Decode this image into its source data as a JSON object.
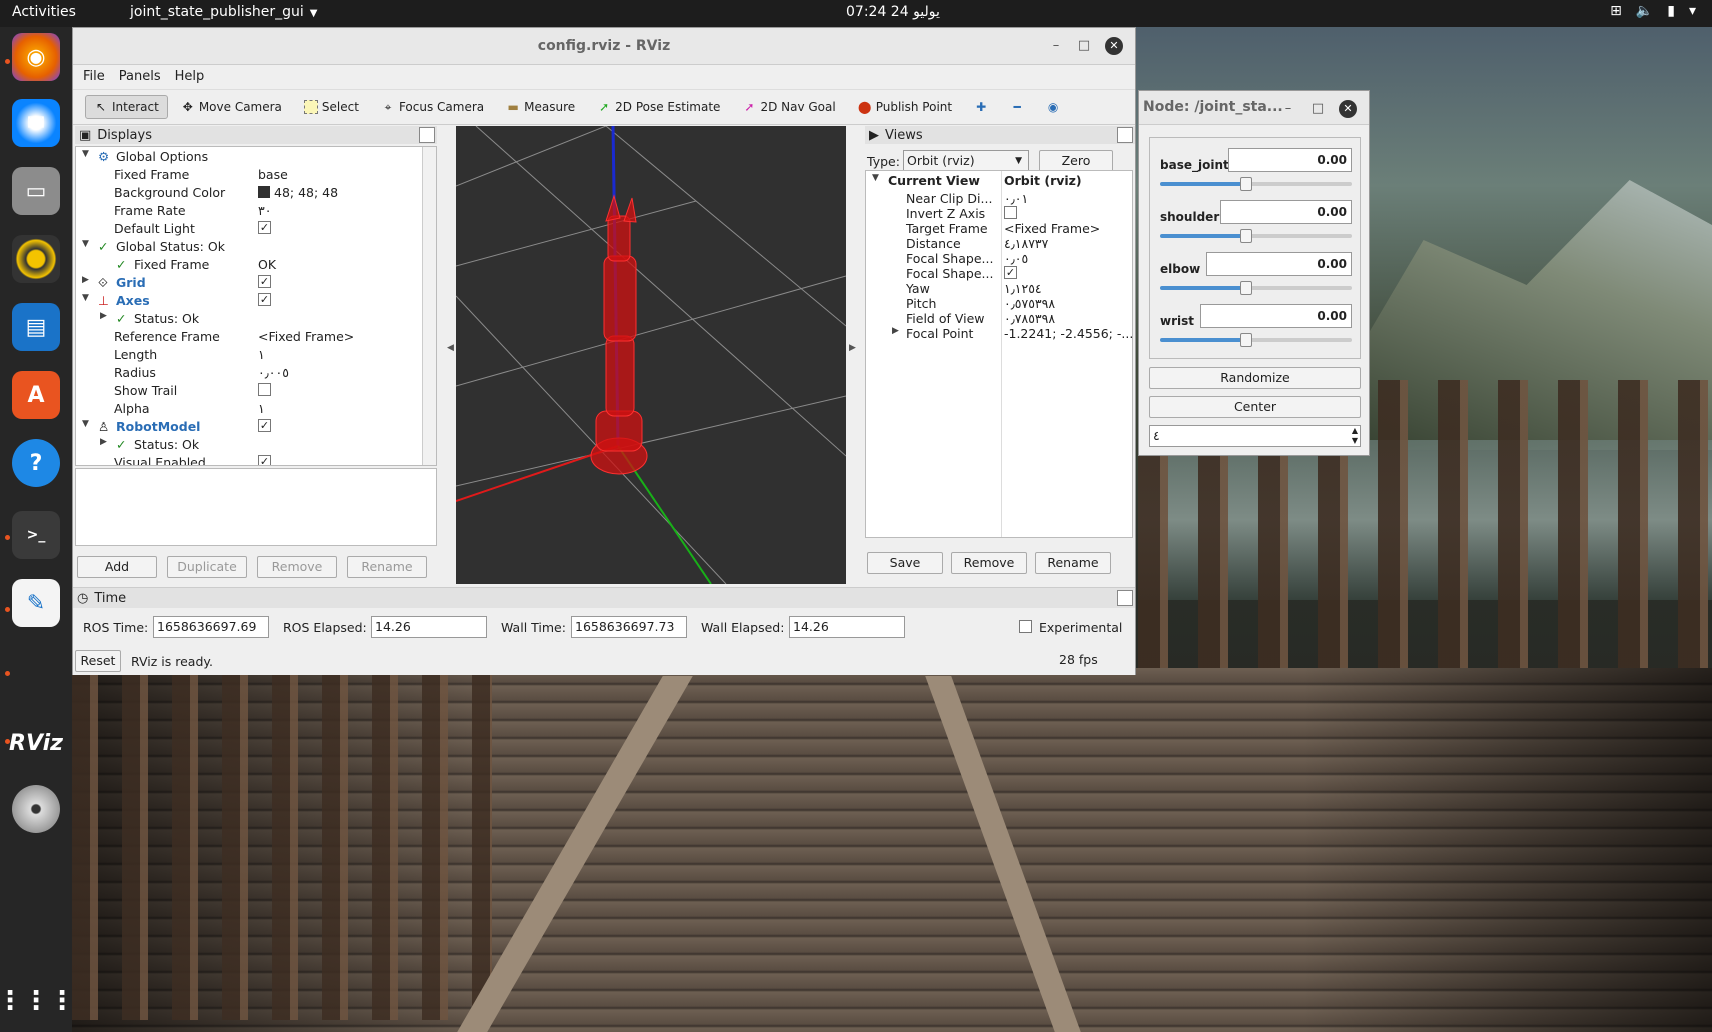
{
  "topbar": {
    "activities": "Activities",
    "app_menu": "joint_state_publisher_gui",
    "clock": "07:24  24 يوليو"
  },
  "dock": {
    "icons": [
      "firefox-icon",
      "thunderbird-icon",
      "files-icon",
      "rhythmbox-icon",
      "writer-icon",
      "software-icon",
      "help-icon",
      "terminal-icon",
      "text-editor-icon",
      "rviz-icon",
      "disc-icon",
      "apps-grid-icon"
    ],
    "rviz_label": "RViz"
  },
  "rviz": {
    "title": "config.rviz - RViz",
    "menu": [
      "File",
      "Panels",
      "Help"
    ],
    "toolbar": [
      "Interact",
      "Move Camera",
      "Select",
      "Focus Camera",
      "Measure",
      "2D Pose Estimate",
      "2D Nav Goal",
      "Publish Point"
    ],
    "displays": {
      "title": "Displays",
      "rows": [
        {
          "k": "Global Options",
          "v": ""
        },
        {
          "k": "Fixed Frame",
          "v": "base"
        },
        {
          "k": "Background Color",
          "v": "48; 48; 48"
        },
        {
          "k": "Frame Rate",
          "v": "٣٠"
        },
        {
          "k": "Default Light",
          "v": ""
        },
        {
          "k": "Global Status: Ok",
          "v": ""
        },
        {
          "k": "Fixed Frame",
          "v": "OK"
        },
        {
          "k": "Grid",
          "v": ""
        },
        {
          "k": "Axes",
          "v": ""
        },
        {
          "k": "Status: Ok",
          "v": ""
        },
        {
          "k": "Reference Frame",
          "v": "<Fixed Frame>"
        },
        {
          "k": "Length",
          "v": "١"
        },
        {
          "k": "Radius",
          "v": "٠٫٠٠٥"
        },
        {
          "k": "Show Trail",
          "v": ""
        },
        {
          "k": "Alpha",
          "v": "١"
        },
        {
          "k": "RobotModel",
          "v": ""
        },
        {
          "k": "Status: Ok",
          "v": ""
        },
        {
          "k": "Visual Enabled",
          "v": ""
        }
      ],
      "buttons": [
        "Add",
        "Duplicate",
        "Remove",
        "Rename"
      ]
    },
    "views": {
      "title": "Views",
      "type_label": "Type:",
      "type_value": "Orbit (rviz)",
      "zero": "Zero",
      "current_view": "Current View",
      "current_view_value": "Orbit (rviz)",
      "rows": [
        {
          "k": "Near Clip Di...",
          "v": "٠٫٠١"
        },
        {
          "k": "Invert Z Axis",
          "v": ""
        },
        {
          "k": "Target Frame",
          "v": "<Fixed Frame>"
        },
        {
          "k": "Distance",
          "v": "٤٫١٨٧٣٧"
        },
        {
          "k": "Focal Shape...",
          "v": "٠٫٠٥"
        },
        {
          "k": "Focal Shape...",
          "v": ""
        },
        {
          "k": "Yaw",
          "v": "١٫١٢٥٤"
        },
        {
          "k": "Pitch",
          "v": "٠٫٥٧٥٣٩٨"
        },
        {
          "k": "Field of View",
          "v": "٠٫٧٨٥٣٩٨"
        },
        {
          "k": "Focal Point",
          "v": "-1.2241; -2.4556; -..."
        }
      ],
      "buttons": [
        "Save",
        "Remove",
        "Rename"
      ]
    },
    "time": {
      "title": "Time",
      "ros_time_label": "ROS Time:",
      "ros_time": "1658636697.69",
      "ros_elapsed_label": "ROS Elapsed:",
      "ros_elapsed": "14.26",
      "wall_time_label": "Wall Time:",
      "wall_time": "1658636697.73",
      "wall_elapsed_label": "Wall Elapsed:",
      "wall_elapsed": "14.26",
      "experimental": "Experimental",
      "reset": "Reset",
      "status": "RViz is ready.",
      "fps": "28 fps"
    }
  },
  "jsp": {
    "title": "Node: /joint_sta...",
    "joints": [
      {
        "name": "base_joint",
        "value": "0.00",
        "level": 0.45
      },
      {
        "name": "shoulder",
        "value": "0.00",
        "level": 0.45
      },
      {
        "name": "elbow",
        "value": "0.00",
        "level": 0.45
      },
      {
        "name": "wrist",
        "value": "0.00",
        "level": 0.45
      }
    ],
    "randomize": "Randomize",
    "center": "Center",
    "spin_value": "٤"
  }
}
